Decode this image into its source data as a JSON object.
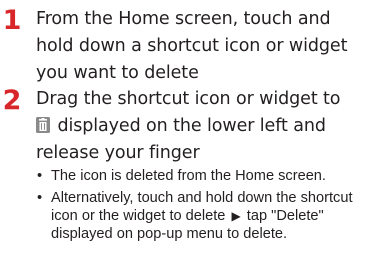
{
  "steps": [
    {
      "number": "1",
      "text": "From the Home screen, touch and hold down a shortcut icon or widget you want to delete"
    },
    {
      "number": "2",
      "text_before_icon": "Drag the shortcut icon or widget to",
      "icon": "trash-icon",
      "text_after_icon": "displayed on the lower left and release your finger"
    }
  ],
  "notes": [
    {
      "bullet": "•",
      "text": "The icon is deleted from the Home screen."
    },
    {
      "bullet": "•",
      "text_before_arrow": "Alternatively, touch and hold down the shortcut icon or the widget to delete",
      "arrow": "▶",
      "text_after_arrow": "tap \"Delete\" displayed on pop-up menu to delete."
    }
  ],
  "colors": {
    "step_number": "#d8272a",
    "text": "#231f20",
    "icon": "#7a7a7a"
  }
}
